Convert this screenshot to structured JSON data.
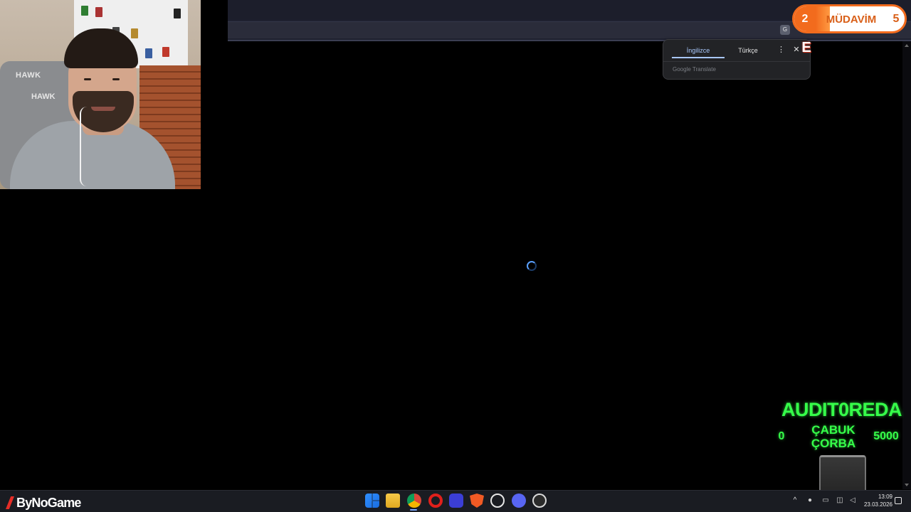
{
  "translate_popup": {
    "tab_source": "İngilizce",
    "tab_target": "Türkçe",
    "more_label": "⋮",
    "close_label": "✕",
    "brand": "Google Translate"
  },
  "overlay_badge": {
    "left_number": "2",
    "name": "MÜDAVİM",
    "right_number": "5",
    "accent_color": "#f26b1d"
  },
  "overlay_letter": "E",
  "goal_widget": {
    "name": "AUDIT0REDA",
    "start": "0",
    "title_line1": "ÇABUK",
    "title_line2": "ÇORBA",
    "end": "5000",
    "color": "#36ff4a"
  },
  "taskbar": {
    "logo": "ByNoGame",
    "apps": [
      "windows-start",
      "file-explorer",
      "chrome",
      "opera",
      "app-f",
      "brave",
      "chatgpt",
      "discord",
      "obs"
    ],
    "tray_chevron": "^",
    "time": "13:09",
    "date": "23.03.2026"
  }
}
